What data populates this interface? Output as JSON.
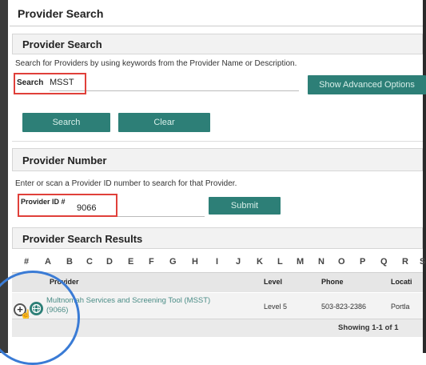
{
  "page_title": "Provider Search",
  "search_section": {
    "title": "Provider Search",
    "hint": "Search for Providers by using keywords from the Provider Name or Description.",
    "search_label": "Search",
    "search_value": "MSST",
    "advanced_button": "Show Advanced Options",
    "search_button": "Search",
    "clear_button": "Clear"
  },
  "number_section": {
    "title": "Provider Number",
    "hint": "Enter or scan a Provider ID number to search for that Provider.",
    "id_label": "Provider ID #",
    "id_value": "9066",
    "submit_button": "Submit"
  },
  "results": {
    "title": "Provider Search Results",
    "alphabet": [
      "#",
      "A",
      "B",
      "C",
      "D",
      "E",
      "F",
      "G",
      "H",
      "I",
      "J",
      "K",
      "L",
      "M",
      "N",
      "O",
      "P",
      "Q",
      "R",
      "S"
    ],
    "columns": {
      "provider": "Provider",
      "level": "Level",
      "phone": "Phone",
      "location": "Locati"
    },
    "rows": [
      {
        "name_line1": "Multnomah Services and Screening Tool (MSST)",
        "name_line2": "(9066)",
        "level": "Level 5",
        "phone": "503-823-2386",
        "location": "Portla"
      }
    ],
    "showing": "Showing 1-1 of 1"
  },
  "colors": {
    "accent": "#2d7f77",
    "highlight": "#e0403a",
    "annotation": "#3a7bd5"
  }
}
